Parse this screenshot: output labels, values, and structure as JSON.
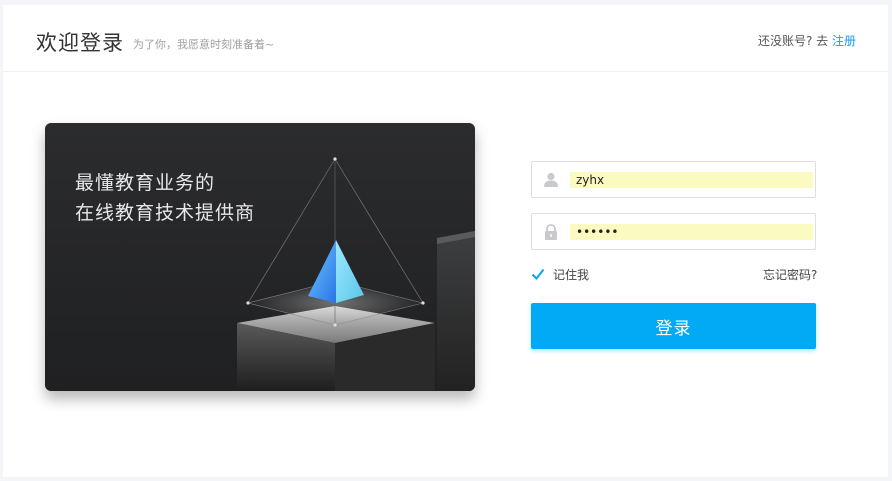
{
  "header": {
    "title": "欢迎登录",
    "subtitle": "为了你，我愿意时刻准备着~",
    "no_account_prefix": "还没账号? 去",
    "register_link": "注册"
  },
  "banner": {
    "line1": "最懂教育业务的",
    "line2": "在线教育技术提供商"
  },
  "form": {
    "username_value": "zyhx",
    "password_value": "••••••",
    "remember_label": "记住我",
    "remember_checked": true,
    "forgot_link": "忘记密码?",
    "login_button": "登录"
  },
  "colors": {
    "accent": "#02a9f4",
    "link": "#1a9be8",
    "autofill": "#fbfbc1"
  },
  "icons": {
    "username": "user-icon",
    "password": "lock-icon",
    "remember": "checkmark-icon"
  }
}
